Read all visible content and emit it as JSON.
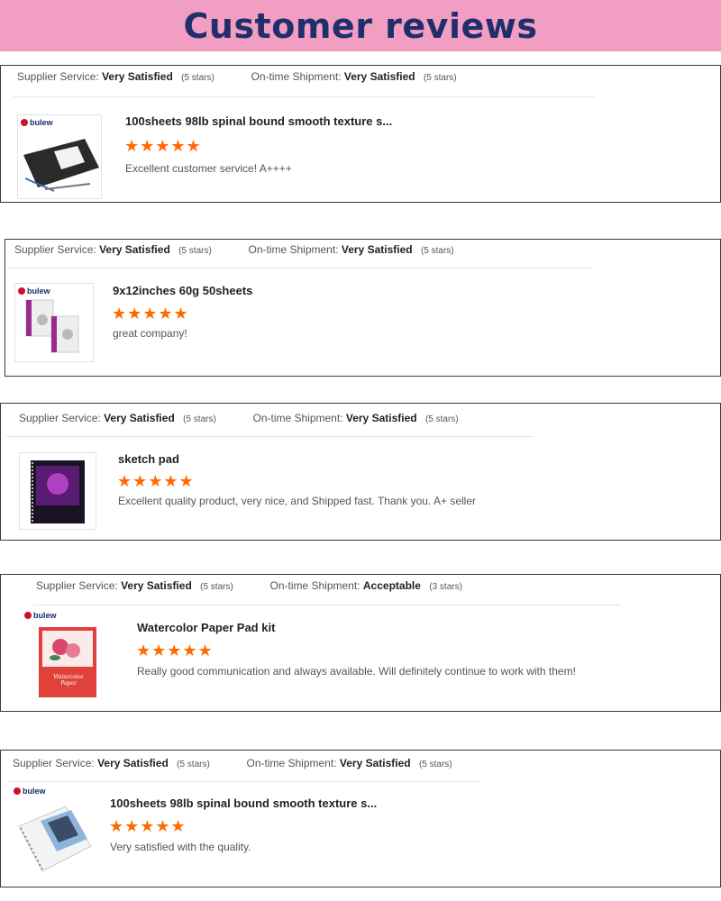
{
  "banner": {
    "title": "Customer reviews"
  },
  "labels": {
    "supplier_service": "Supplier Service:",
    "ontime_shipment": "On-time Shipment:",
    "brand": "bulew"
  },
  "colors": {
    "banner_bg": "#f19ec2",
    "banner_text": "#1f2f6b",
    "star": "#ff6a00"
  },
  "reviews": [
    {
      "supplier_rating": "Very Satisfied",
      "supplier_stars": "(5 stars)",
      "shipment_rating": "Very Satisfied",
      "shipment_stars": "(5 stars)",
      "product": "100sheets 98lb spinal bound smooth texture s...",
      "rating": 5,
      "stars": "★★★★★",
      "comment": "Excellent customer service! A++++"
    },
    {
      "supplier_rating": "Very Satisfied",
      "supplier_stars": "(5 stars)",
      "shipment_rating": "Very Satisfied",
      "shipment_stars": "(5 stars)",
      "product": "9x12inches 60g 50sheets",
      "rating": 5,
      "stars": "★★★★★",
      "comment": "great company!"
    },
    {
      "supplier_rating": "Very Satisfied",
      "supplier_stars": "(5 stars)",
      "shipment_rating": "Very Satisfied",
      "shipment_stars": "(5 stars)",
      "product": "sketch pad",
      "rating": 5,
      "stars": "★★★★★",
      "comment": "Excellent quality product, very nice, and Shipped fast. Thank you. A+ seller"
    },
    {
      "supplier_rating": "Very Satisfied",
      "supplier_stars": "(5 stars)",
      "shipment_rating": "Acceptable",
      "shipment_stars": "(3 stars)",
      "product": "Watercolor Paper Pad kit",
      "rating": 5,
      "stars": "★★★★★",
      "comment": "Really good communication and always available. Will definitely continue to work with them!",
      "cover_text": "Watercolor Paper"
    },
    {
      "supplier_rating": "Very Satisfied",
      "supplier_stars": "(5 stars)",
      "shipment_rating": "Very Satisfied",
      "shipment_stars": "(5 stars)",
      "product": "100sheets 98lb spinal bound smooth texture s...",
      "rating": 5,
      "stars": "★★★★★",
      "comment": "Very satisfied with the quality."
    }
  ]
}
